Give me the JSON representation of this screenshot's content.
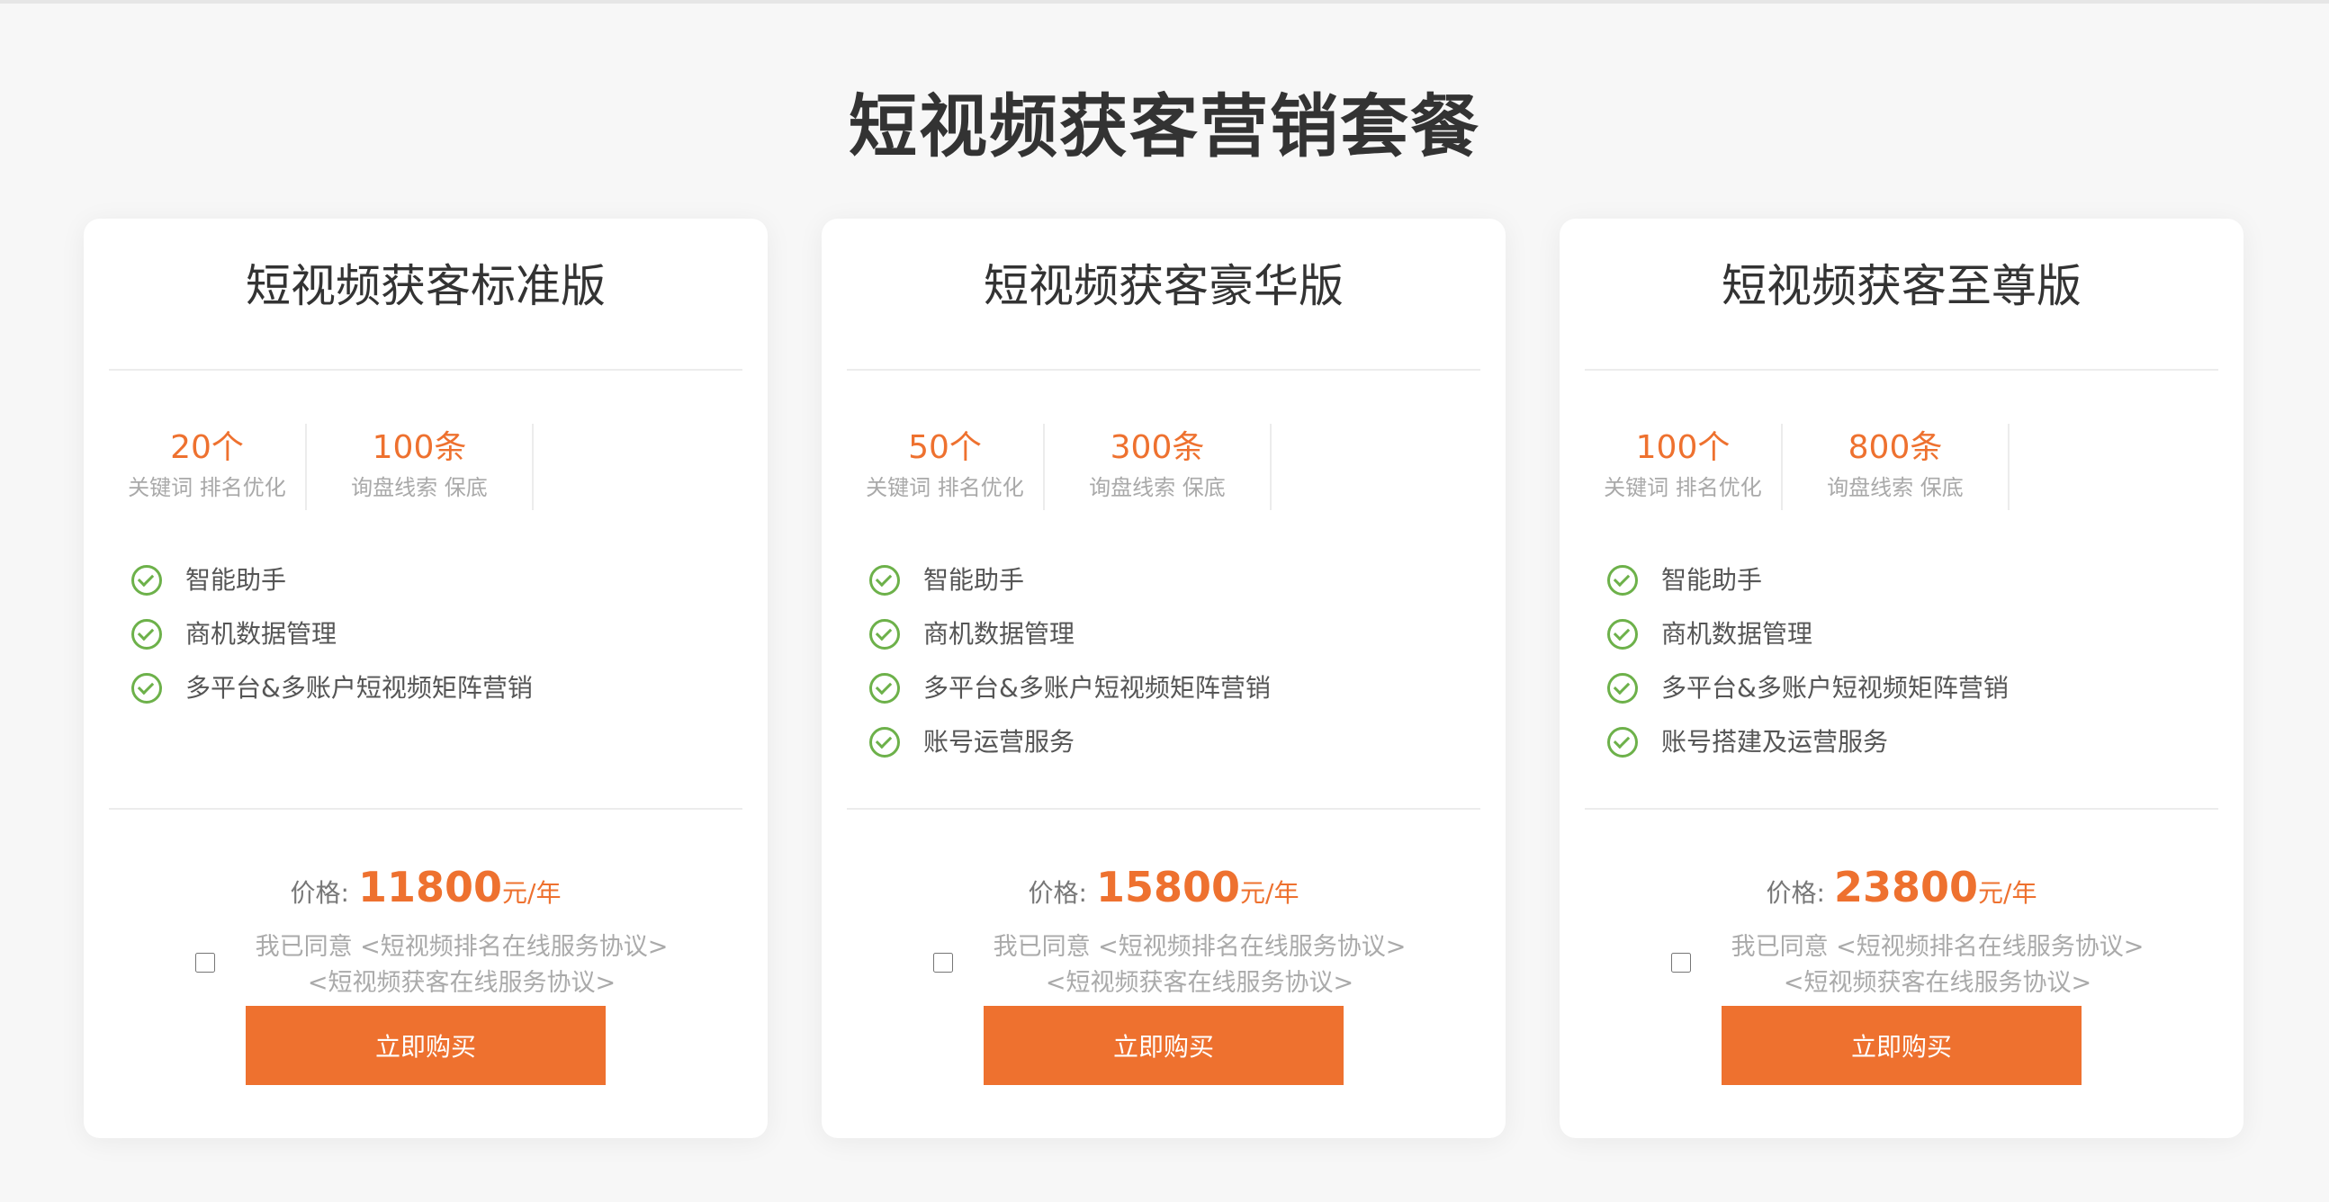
{
  "page": {
    "title": "短视频获客营销套餐"
  },
  "colors": {
    "accent": "#ee712f",
    "check": "#6db14a",
    "background": "#f7f7f7"
  },
  "plans": [
    {
      "title": "短视频获客标准版",
      "stats": [
        {
          "value": "20个",
          "label": "关键词 排名优化"
        },
        {
          "value": "100条",
          "label": "询盘线索 保底"
        }
      ],
      "features": [
        "智能助手",
        "商机数据管理",
        "多平台&多账户短视频矩阵营销"
      ],
      "price_label": "价格:",
      "price": "11800",
      "price_unit": "元/年",
      "agree_line1": "我已同意 <短视频排名在线服务协议>",
      "agree_line2": "<短视频获客在线服务协议>",
      "agreed": false,
      "buy_label": "立即购买"
    },
    {
      "title": "短视频获客豪华版",
      "stats": [
        {
          "value": "50个",
          "label": "关键词 排名优化"
        },
        {
          "value": "300条",
          "label": "询盘线索 保底"
        }
      ],
      "features": [
        "智能助手",
        "商机数据管理",
        "多平台&多账户短视频矩阵营销",
        "账号运营服务"
      ],
      "price_label": "价格:",
      "price": "15800",
      "price_unit": "元/年",
      "agree_line1": "我已同意 <短视频排名在线服务协议>",
      "agree_line2": "<短视频获客在线服务协议>",
      "agreed": false,
      "buy_label": "立即购买"
    },
    {
      "title": "短视频获客至尊版",
      "stats": [
        {
          "value": "100个",
          "label": "关键词 排名优化"
        },
        {
          "value": "800条",
          "label": "询盘线索 保底"
        }
      ],
      "features": [
        "智能助手",
        "商机数据管理",
        "多平台&多账户短视频矩阵营销",
        "账号搭建及运营服务"
      ],
      "price_label": "价格:",
      "price": "23800",
      "price_unit": "元/年",
      "agree_line1": "我已同意 <短视频排名在线服务协议>",
      "agree_line2": "<短视频获客在线服务协议>",
      "agreed": false,
      "buy_label": "立即购买"
    }
  ]
}
